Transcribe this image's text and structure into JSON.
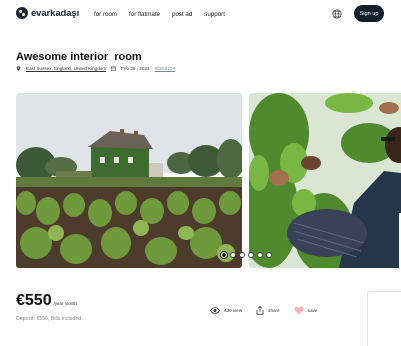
{
  "header": {
    "logo_text": "evarkadaşı",
    "nav": [
      "for room",
      "for flatmate",
      "post ad",
      "support"
    ],
    "signup_label": "Sign up",
    "icons": {
      "language": "globe-icon",
      "logo": "logo-icon"
    }
  },
  "listing": {
    "title": "Awesome interior  room",
    "location": "East Sussex, England, United Kingdom",
    "date": "Feb 28 , 2023",
    "ref": "#5550203"
  },
  "gallery": {
    "images": [
      "house-vineyard-photo",
      "people-plants-photo"
    ],
    "dot_count": 6,
    "active_dot": 0
  },
  "pricing": {
    "amount": "€550",
    "unit": "/year month",
    "deposit": "Deposit: €550,  Bills included"
  },
  "actions": {
    "views_label": "430 view",
    "share_label": "share",
    "save_label": "save"
  },
  "colors": {
    "brand_dark": "#13202c",
    "heart": "#f5b5b5"
  }
}
